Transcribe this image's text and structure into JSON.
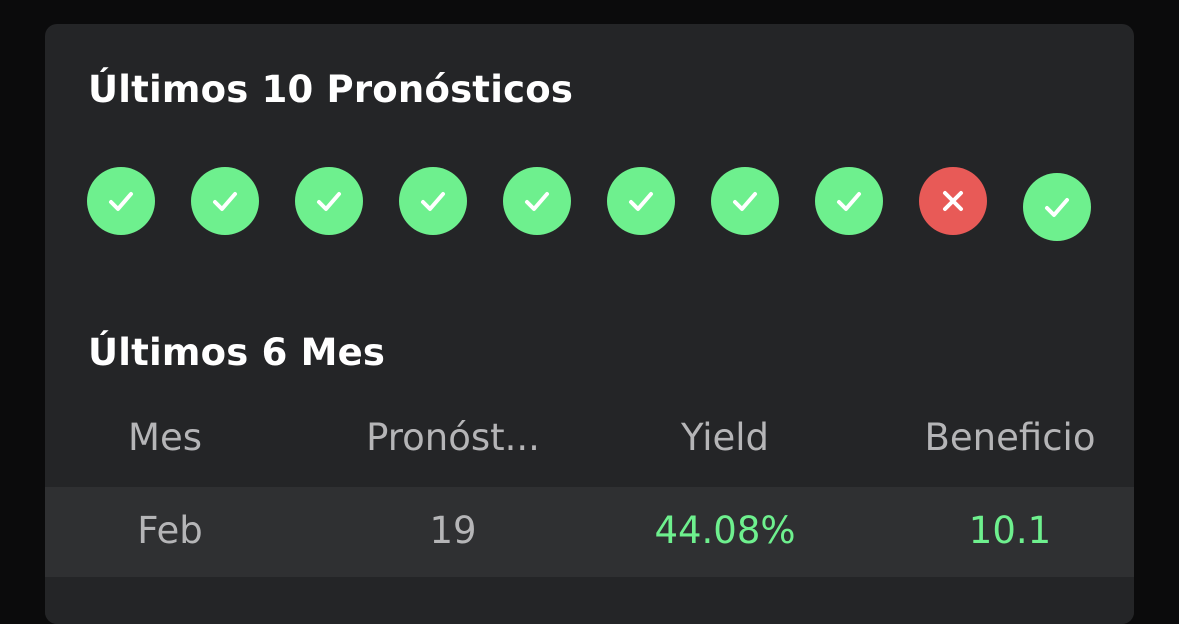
{
  "recent": {
    "title": "Últimos 10 Pronósticos",
    "results": [
      "win",
      "win",
      "win",
      "win",
      "win",
      "win",
      "win",
      "win",
      "loss",
      "win"
    ],
    "colors": {
      "win": "#6ef08e",
      "loss": "#e85a57"
    }
  },
  "monthly": {
    "title": "Últimos 6 Mes",
    "columns": [
      "Mes",
      "Pronóst...",
      "Yield",
      "Beneficio"
    ],
    "rows": [
      {
        "month": "Feb",
        "picks": "19",
        "yield": "44.08%",
        "profit": "10.1"
      }
    ]
  }
}
